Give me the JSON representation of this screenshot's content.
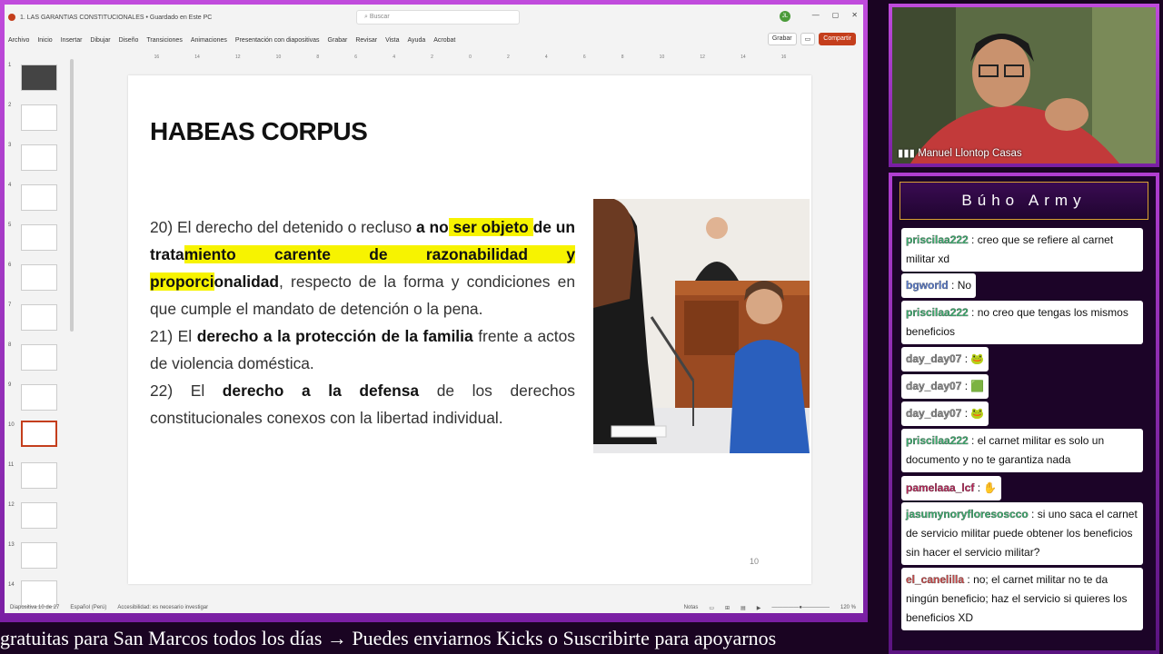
{
  "window": {
    "title": "1. LAS GARANTIAS CONSTITUCIONALES • Guardado en Este PC",
    "search_placeholder": "Buscar",
    "user_initials": "JL"
  },
  "ribbon": {
    "tabs": [
      "Archivo",
      "Inicio",
      "Insertar",
      "Dibujar",
      "Diseño",
      "Transiciones",
      "Animaciones",
      "Presentación con diapositivas",
      "Grabar",
      "Revisar",
      "Vista",
      "Ayuda",
      "Acrobat"
    ],
    "record_label": "Grabar",
    "share_label": "Compartir"
  },
  "ruler": [
    "16",
    "15",
    "14",
    "13",
    "12",
    "11",
    "10",
    "9",
    "8",
    "7",
    "6",
    "5",
    "4",
    "3",
    "2",
    "1",
    "0",
    "1",
    "2",
    "3",
    "4",
    "5",
    "6",
    "7",
    "8",
    "9",
    "10",
    "11",
    "12",
    "13",
    "14",
    "15",
    "16"
  ],
  "thumbnails": {
    "numbers": [
      "1",
      "2",
      "3",
      "4",
      "5",
      "6",
      "7",
      "8",
      "9",
      "10",
      "11",
      "12",
      "13",
      "14"
    ],
    "active_index": 10
  },
  "slide": {
    "title": "HABEAS CORPUS",
    "p20_a": "20) El derecho del detenido o recluso ",
    "p20_b": "a no",
    "p20_c": " ser objeto ",
    "p20_d": "de un trata",
    "p20_e": "miento carente de razonabilidad y proporci",
    "p20_f": "onalidad",
    "p20_g": ", respecto de la forma y condiciones en que cumple el mandato de detención o la pena.",
    "p21_a": "21) El ",
    "p21_b": "derecho a la protección de la familia",
    "p21_c": " frente a actos de violencia doméstica.",
    "p22_a": "22) El ",
    "p22_b": "derecho a la defensa",
    "p22_c": " de los derechos constitucionales conexos con la libertad individual.",
    "number": "10"
  },
  "statusbar": {
    "slide_count": "Diapositiva 10 de 27",
    "language": "Español (Perú)",
    "accessibility": "Accesibilidad: es necesario investigar",
    "notes": "Notas",
    "zoom": "120 %"
  },
  "webcam": {
    "name": "Manuel Llontop Casas"
  },
  "chat": {
    "title": "Búho Army",
    "messages": [
      {
        "user": "priscilaa222",
        "color": "#3cb371",
        "text": "creo que se refiere al carnet militar xd"
      },
      {
        "user": "bgworld",
        "color": "#5b7fd6",
        "text": "No"
      },
      {
        "user": "priscilaa222",
        "color": "#3cb371",
        "text": "no creo que tengas los mismos beneficios"
      },
      {
        "user": "day_day07",
        "color": "#8a8a8a",
        "text": "🐸"
      },
      {
        "user": "day_day07",
        "color": "#8a8a8a",
        "text": "🟩"
      },
      {
        "user": "day_day07",
        "color": "#8a8a8a",
        "text": "🐸"
      },
      {
        "user": "priscilaa222",
        "color": "#3cb371",
        "text": "el carnet militar es solo un documento y no te garantiza nada"
      },
      {
        "user": "pamelaaa_lcf",
        "color": "#c0245a",
        "text": "✋"
      },
      {
        "user": "jasumynoryfloresoscco",
        "color": "#3cb371",
        "text": "si uno saca el carnet de servicio militar puede obtener los beneficios sin hacer el servicio militar?"
      },
      {
        "user": "el_canelilla",
        "color": "#d04a4a",
        "text": "no; el carnet militar no te da ningún beneficio; haz el servicio si quieres los beneficios XD"
      }
    ]
  },
  "ticker": {
    "text": "gratuitas para San Marcos todos los días  →  Puedes enviarnos Kicks o Suscribirte para apoyarnos"
  },
  "colors": {
    "accent": "#c43e1c",
    "highlight": "#f7f300",
    "frame": "#b03ed0"
  }
}
